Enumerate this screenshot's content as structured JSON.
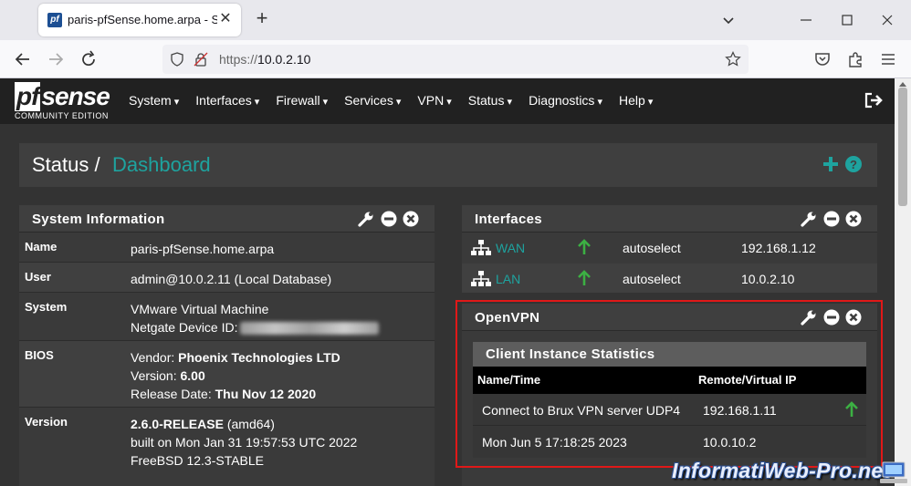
{
  "browser": {
    "tab_title": "paris-pfSense.home.arpa - Status",
    "new_tab": "+",
    "url_scheme": "https://",
    "url_host": "10.0.2.10"
  },
  "app": {
    "logo_text": "sense",
    "logo_prefix": "pf",
    "logo_sub": "COMMUNITY EDITION",
    "menu": [
      "System",
      "Interfaces",
      "Firewall",
      "Services",
      "VPN",
      "Status",
      "Diagnostics",
      "Help"
    ]
  },
  "breadcrumb": {
    "section": "Status /",
    "page": "Dashboard"
  },
  "system_info": {
    "title": "System Information",
    "name_label": "Name",
    "name_value": "paris-pfSense.home.arpa",
    "user_label": "User",
    "user_value": "admin@10.0.2.11 (Local Database)",
    "system_label": "System",
    "system_value": "VMware Virtual Machine",
    "system_device_label": "Netgate Device ID:",
    "bios_label": "BIOS",
    "bios_vendor_label": "Vendor: ",
    "bios_vendor": "Phoenix Technologies LTD",
    "bios_version_label": "Version: ",
    "bios_version": "6.00",
    "bios_date_label": "Release Date: ",
    "bios_date": "Thu Nov 12 2020",
    "version_label": "Version",
    "version_release": "2.6.0-RELEASE",
    "version_arch": " (amd64)",
    "version_built": "built on Mon Jan 31 19:57:53 UTC 2022",
    "version_os": "FreeBSD 12.3-STABLE"
  },
  "interfaces": {
    "title": "Interfaces",
    "rows": [
      {
        "name": "WAN",
        "media": "autoselect",
        "ip": "192.168.1.12"
      },
      {
        "name": "LAN",
        "media": "autoselect",
        "ip": "10.0.2.10"
      }
    ]
  },
  "openvpn": {
    "title": "OpenVPN",
    "subtitle": "Client Instance Statistics",
    "col_name": "Name/Time",
    "col_ip": "Remote/Virtual IP",
    "row1_name": "Connect to Brux VPN server UDP4",
    "row1_ip": "192.168.1.11",
    "row2_name": "Mon Jun 5 17:18:25 2023",
    "row2_ip": "10.0.10.2"
  },
  "watermark": "InformatiWeb-Pro.net",
  "colors": {
    "accent": "#1ea39f",
    "up_arrow": "#3cb043",
    "highlight_box": "#e01818"
  }
}
